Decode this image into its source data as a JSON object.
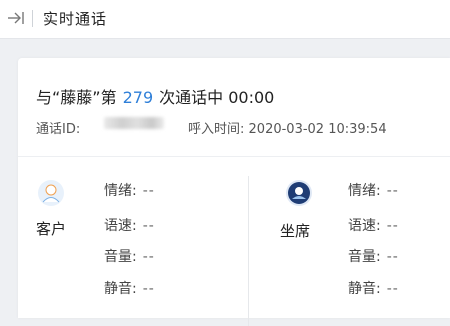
{
  "header": {
    "back_icon": "arrow-right-bar-icon",
    "title": "实时通话"
  },
  "call": {
    "prefix": "与“藤藤”第",
    "count": "279",
    "suffix": "次通话中",
    "duration": "00:00",
    "call_id_label": "通话ID:",
    "incoming_time_label": "呼入时间:",
    "incoming_time": "2020-03-02 10:39:54"
  },
  "customer": {
    "label": "客户",
    "avatar_icon": "customer-avatar-icon",
    "stats": [
      {
        "label": "情绪:",
        "value": "--"
      },
      {
        "label": "语速:",
        "value": "--"
      },
      {
        "label": "音量:",
        "value": "--"
      },
      {
        "label": "静音:",
        "value": "--"
      }
    ]
  },
  "agent": {
    "label": "坐席",
    "avatar_icon": "agent-avatar-icon",
    "stats": [
      {
        "label": "情绪:",
        "value": "--"
      },
      {
        "label": "语速:",
        "value": "--"
      },
      {
        "label": "音量:",
        "value": "--"
      },
      {
        "label": "静音:",
        "value": "--"
      }
    ]
  }
}
